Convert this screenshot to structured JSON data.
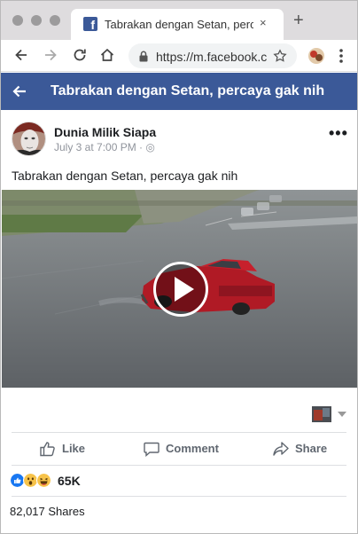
{
  "browser": {
    "tab_title": "Tabrakan dengan Setan, percaya gak nih",
    "tab_close": "×",
    "new_tab": "+",
    "favicon_letter": "f",
    "url": "https://m.facebook.com"
  },
  "fb_header": {
    "title": "Tabrakan dengan Setan, percaya gak nih"
  },
  "post": {
    "author": "Dunia Milik Siapa",
    "meta": "July 3 at 7:00 PM · ◎",
    "more": "•••",
    "text": "Tabrakan dengan Setan, percaya gak nih"
  },
  "actions": {
    "like": "Like",
    "comment": "Comment",
    "share": "Share"
  },
  "reactions": {
    "types": [
      "like",
      "wow",
      "haha"
    ],
    "count": "65K"
  },
  "shares": "82,017 Shares",
  "colors": {
    "facebook_blue": "#3b5998",
    "like_blue": "#1877f2",
    "emoji_yellow": "#f7c34a"
  }
}
